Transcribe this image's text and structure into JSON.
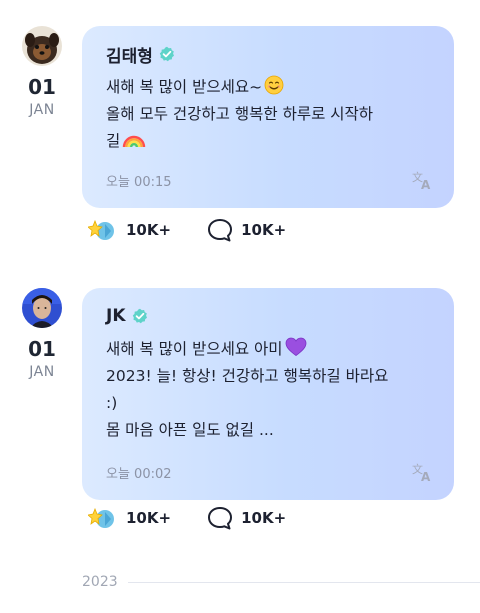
{
  "posts": [
    {
      "date": {
        "day": "01",
        "month": "JAN"
      },
      "author": "김태형",
      "verified": true,
      "message_lines": [
        "새해 복 많이 받으세요~",
        "올해 모두 건강하고 행복한 하루로 시작하",
        "길"
      ],
      "emojis": [
        "smiling-face",
        "rainbow"
      ],
      "timestamp": "오늘 00:15",
      "reactions": {
        "likes": "10K+",
        "comments": "10K+"
      }
    },
    {
      "date": {
        "day": "01",
        "month": "JAN"
      },
      "author": "JK",
      "verified": true,
      "message_lines": [
        "새해 복 많이 받으세요 아미",
        "2023! 늘! 항상! 건강하고 행복하길 바라요",
        ":)",
        "몸 마음 아픈 일도 없길 ..."
      ],
      "emojis": [
        "purple-heart"
      ],
      "timestamp": "오늘 00:02",
      "reactions": {
        "likes": "10K+",
        "comments": "10K+"
      }
    }
  ],
  "year_divider": "2023",
  "colors": {
    "bubble_start": "#dceaff",
    "bubble_end": "#c4d3ff",
    "verified": "#5ed3c9",
    "text": "#1d2130",
    "muted": "#8c93a6"
  }
}
